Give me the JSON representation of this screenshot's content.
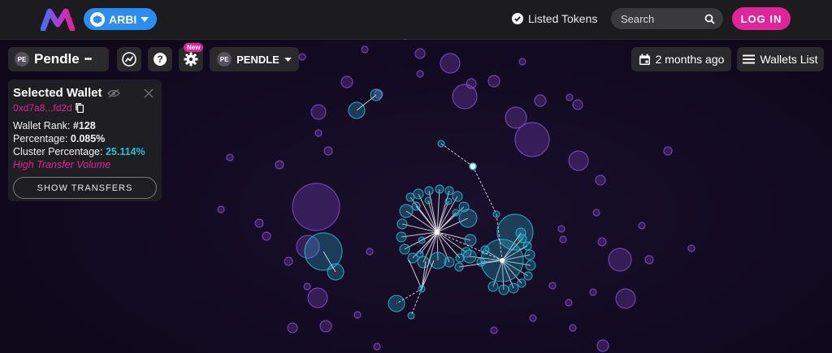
{
  "header": {
    "chain_label": "ARBI",
    "listed_tokens": "Listed Tokens",
    "search_placeholder": "Search",
    "login_label": "LOG IN"
  },
  "toolbar": {
    "token_badge": "PE",
    "token_name": "Pendle",
    "more_label": "•••",
    "new_badge": "New",
    "selector_badge": "PE",
    "selector_label": "PENDLE",
    "date_label": "2 months ago",
    "wallets_list_label": "Wallets List"
  },
  "wallet_panel": {
    "title": "Selected Wallet",
    "address": "0xd7a8...fd2d",
    "rank_label": "Wallet Rank: ",
    "rank_value": "#128",
    "percentage_label": "Percentage: ",
    "percentage_value": "0.085%",
    "cluster_label": "Cluster Percentage: ",
    "cluster_value": "25.114%",
    "tag": "High Transfer Volume",
    "show_transfers": "SHOW TRANSFERS"
  },
  "colors": {
    "accent_pink": "#e0249a",
    "chain_blue": "#2c8df0",
    "cyan": "#2bbcd6",
    "purple": "#8a4fd8"
  }
}
